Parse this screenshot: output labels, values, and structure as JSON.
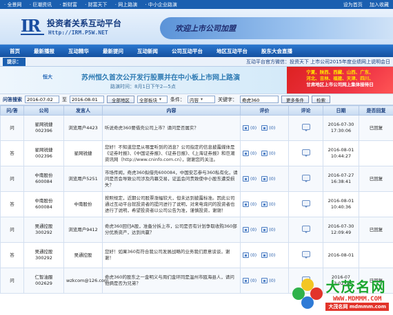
{
  "topbar": {
    "links": [
      "全景网",
      "巨潮资讯",
      "新财富",
      "财富天下",
      "网上路演",
      "中小企业路演"
    ],
    "right": [
      "设为首页",
      "加入收藏"
    ]
  },
  "brand": {
    "mark": "IR",
    "title": "投资者关系互动平台",
    "url": "Http://IRM.P5W.NET",
    "welcome": "欢迎上市公司加盟"
  },
  "nav": [
    "首页",
    "最新播报",
    "互动精华",
    "最新提问",
    "互动新闻",
    "公司互动平台",
    "地区互动平台",
    "股东大会直播"
  ],
  "notice": {
    "tip": "提示：",
    "text": "互动平台官方微信：投资天下      上市公司2015年度业绩网上说明会日"
  },
  "ad": {
    "company": "恒大",
    "headline": "苏州恒久首次公开发行股票并在中小板上市网上路演",
    "sub": "路演时间：8月1日下午2—5点",
    "red_lines": [
      "宁夏、陕西、西藏、山西、广东、",
      "河北、吉林、福建、天津、四川、",
      "甘肃地区上市公司网上集体接待日"
    ]
  },
  "search": {
    "label": "问答搜索",
    "from": "2016-07-02",
    "to_label": "至",
    "to": "2016-08-01",
    "region_btn": "全部地区",
    "sector": "全部板块",
    "cond_label": "条件：",
    "cond": "内容",
    "kw_label": "关键字：",
    "kw": "奇虎360",
    "more_btn": "更多条件",
    "search_btn": "检索"
  },
  "table": {
    "headers": [
      "问/答",
      "公司",
      "发言人",
      "内容",
      "评价",
      "评论",
      "日期",
      "是否回复"
    ],
    "rows": [
      {
        "type": "q",
        "kind": "问",
        "company": "星网锐捷",
        "code": "002396",
        "speaker": "浏览用户4423",
        "content": "听说奇虎360要借壳公司上市？请问是否属实？",
        "votes": "(0)",
        "vote2": "(0)",
        "date": "2016-07-30",
        "time": "17:30:06",
        "replied": "已回复"
      },
      {
        "type": "a",
        "kind": "答",
        "company": "星网锐捷",
        "code": "002396",
        "speaker": "星网锐捷",
        "content": "您好！不知道您是从哪里听到的消息？公司指定的信息披露媒体是《证券时报》、《中国证券报》、《证券日报》、《上海证券报》和巨潮资讯网（http://www.cninfo.com.cn），谢谢您的关注。",
        "votes": "(0)",
        "vote2": "(0)",
        "date": "2016-08-01",
        "time": "10:44:27",
        "replied": ""
      },
      {
        "type": "q",
        "kind": "问",
        "company": "中南股份",
        "code": "600084",
        "speaker": "浏览用户5251",
        "content": "市场传闻，奇虎360拟借壳600084，中国安芯参与360私有化，请问是否会导致公司涉及内幕交易，证监会问责致使中小股东遭受损失？",
        "votes": "(0)",
        "vote2": "(0)",
        "date": "2016-07-27",
        "time": "16:38:41",
        "replied": "已回复"
      },
      {
        "type": "a",
        "kind": "答",
        "company": "中南股份",
        "code": "600084",
        "speaker": "中南股份",
        "content": "按照规定，近期公司股票涨幅较大，但未达到披露标准。因此公司通过互动平台就投资者的提问进行了说明，对来电询问的投资者也进行了说明，希望投资者以公司公告为准，谨慎投资，谢谢！",
        "votes": "(0)",
        "vote2": "(0)",
        "date": "2016-08-01",
        "time": "10:40:36",
        "replied": ""
      },
      {
        "type": "q",
        "kind": "问",
        "company": "吴通控股",
        "code": "300292",
        "speaker": "浏览用户9412",
        "content": "奇虎360回归A股，准备分拆上市，公司是否有计划争取收购360部分优质资产，达到共赢？",
        "votes": "(0)",
        "vote2": "(0)",
        "date": "2016-07-30",
        "time": "12:09:49",
        "replied": "已回复"
      },
      {
        "type": "a",
        "kind": "答",
        "company": "吴通控股",
        "code": "300292",
        "speaker": "吴通控股",
        "content": "您好！如果360有符合我公司发展战略的业务我们愿意谈谈，谢谢！",
        "votes": "(0)",
        "vote2": "(0)",
        "date": "2016-08-01",
        "time": "",
        "replied": ""
      },
      {
        "type": "q",
        "kind": "问",
        "company": "仁智油服",
        "code": "002629",
        "speaker": "wzkcom@126.com",
        "content": "奇虎360的股东之一金明义与周们金环同是温州市瓯海县人，请问他俩是否为兄弟？",
        "votes": "(0)",
        "vote2": "(0)",
        "date": "2016-07",
        "time": "23:02:06",
        "replied": "已回复"
      }
    ]
  },
  "watermark": {
    "brand": "大茂名网",
    "url": "WWW.MDMMM.COM",
    "tag": "大茂名网 mdmmm.com"
  }
}
